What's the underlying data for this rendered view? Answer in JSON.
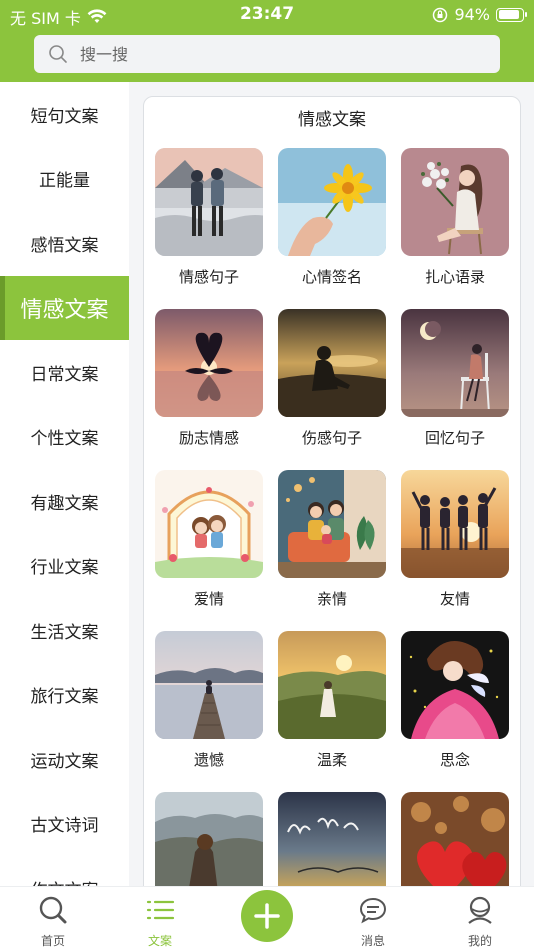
{
  "statusbar": {
    "carrier": "无 SIM 卡",
    "time": "23:47",
    "battery": "94%",
    "battery_level": 0.94
  },
  "search": {
    "placeholder": "搜一搜"
  },
  "sidebar": {
    "items": [
      {
        "label": "短句文案"
      },
      {
        "label": "正能量"
      },
      {
        "label": "感悟文案"
      },
      {
        "label": "情感文案",
        "active": true
      },
      {
        "label": "日常文案"
      },
      {
        "label": "个性文案"
      },
      {
        "label": "有趣文案"
      },
      {
        "label": "行业文案"
      },
      {
        "label": "生活文案"
      },
      {
        "label": "旅行文案"
      },
      {
        "label": "运动文案"
      },
      {
        "label": "古文诗词"
      },
      {
        "label": "作文文案"
      }
    ]
  },
  "panel": {
    "title": "情感文案",
    "cards": [
      {
        "label": "情感句子",
        "image": "couple-at-sea"
      },
      {
        "label": "心情签名",
        "image": "hand-holding-flower"
      },
      {
        "label": "扎心语录",
        "image": "girl-with-bouquet"
      },
      {
        "label": "励志情感",
        "image": "swans-heart-sunset"
      },
      {
        "label": "伤感句子",
        "image": "sad-girl-sunset"
      },
      {
        "label": "回忆句子",
        "image": "girl-on-chair-moon"
      },
      {
        "label": "爱情",
        "image": "cartoon-couple"
      },
      {
        "label": "亲情",
        "image": "cartoon-family"
      },
      {
        "label": "友情",
        "image": "friends-sunset"
      },
      {
        "label": "遗憾",
        "image": "person-on-pier"
      },
      {
        "label": "温柔",
        "image": "girl-in-field"
      },
      {
        "label": "思念",
        "image": "fairy-girl"
      },
      {
        "label": "",
        "image": "girl-mountain-view"
      },
      {
        "label": "",
        "image": "handwriting-sunset"
      },
      {
        "label": "",
        "image": "red-hearts"
      }
    ]
  },
  "tabbar": {
    "tabs": [
      {
        "label": "首页",
        "icon": "search-icon"
      },
      {
        "label": "文案",
        "icon": "list-icon",
        "active": true
      },
      {
        "label": "",
        "icon": "plus-icon"
      },
      {
        "label": "消息",
        "icon": "message-icon"
      },
      {
        "label": "我的",
        "icon": "user-icon"
      }
    ]
  },
  "colors": {
    "accent": "#8cc43d",
    "accent_dark": "#6b9c2a",
    "text": "#222222"
  }
}
